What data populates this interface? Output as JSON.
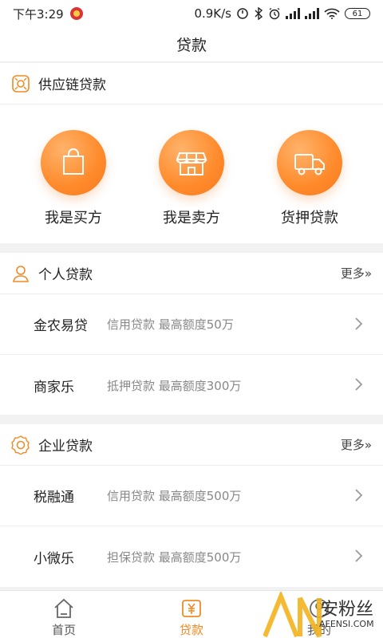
{
  "status": {
    "time": "下午3:29",
    "net_speed": "0.9K/s",
    "battery": "61"
  },
  "appbar": {
    "title": "贷款"
  },
  "supply": {
    "title": "供应链贷款",
    "items": [
      {
        "label": "我是买方",
        "icon": "shopping-bag-icon"
      },
      {
        "label": "我是卖方",
        "icon": "storefront-icon"
      },
      {
        "label": "货押贷款",
        "icon": "truck-icon"
      }
    ]
  },
  "personal": {
    "title": "个人贷款",
    "more": "更多»",
    "rows": [
      {
        "name": "金农易贷",
        "desc": "信用贷款 最高额度50万"
      },
      {
        "name": "商家乐",
        "desc": "抵押贷款 最高额度300万"
      }
    ]
  },
  "enterprise": {
    "title": "企业贷款",
    "more": "更多»",
    "rows": [
      {
        "name": "税融通",
        "desc": "信用贷款 最高额度500万"
      },
      {
        "name": "小微乐",
        "desc": "担保贷款 最高额度500万"
      }
    ]
  },
  "tabs": [
    {
      "label": "首页",
      "icon": "home-icon"
    },
    {
      "label": "贷款",
      "icon": "yen-icon"
    },
    {
      "label": "我的",
      "icon": "profile-icon"
    }
  ],
  "watermark": {
    "text": "安粉丝",
    "sub": "AFENSI.COM"
  },
  "colors": {
    "accent": "#f08a24",
    "orange": "#ff8a2b"
  }
}
